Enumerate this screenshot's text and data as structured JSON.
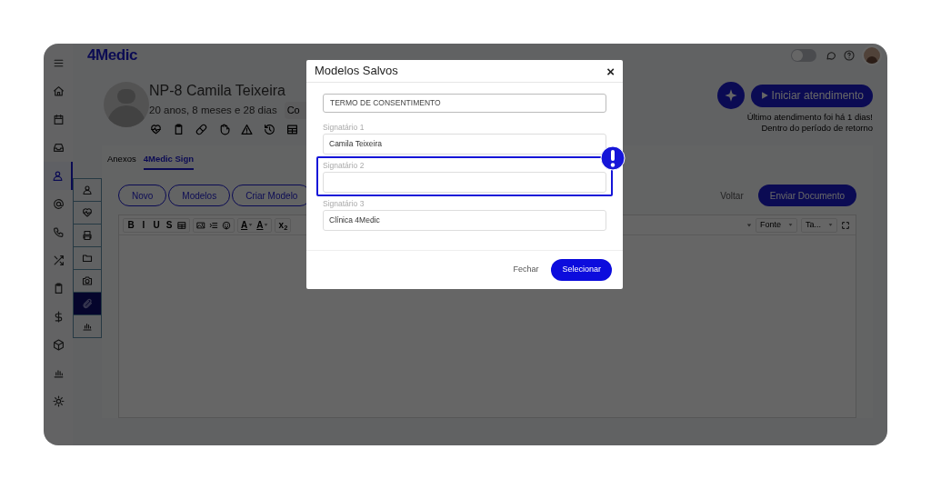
{
  "app": {
    "logo": "4Medic"
  },
  "sidebar": {
    "items": [
      {
        "kind": "menu",
        "selected": false
      },
      {
        "kind": "home",
        "selected": false
      },
      {
        "kind": "calendar",
        "selected": false
      },
      {
        "kind": "inbox",
        "selected": false
      },
      {
        "kind": "user",
        "selected": true
      },
      {
        "kind": "at",
        "selected": false
      },
      {
        "kind": "phone",
        "selected": false
      },
      {
        "kind": "shuffle",
        "selected": false
      },
      {
        "kind": "clipboard",
        "selected": false
      },
      {
        "kind": "dollar",
        "selected": false
      },
      {
        "kind": "cube",
        "selected": false
      },
      {
        "kind": "chart",
        "selected": false
      },
      {
        "kind": "gear",
        "selected": false
      }
    ]
  },
  "topbar": {
    "toggle": {
      "on": false
    }
  },
  "patient": {
    "name": "NP-8 Camila Teixeira",
    "age": "20 anos, 8 meses e 28 dias",
    "badge": "Co"
  },
  "actions": {
    "start_button": "Iniciar atendimento",
    "note_lines": [
      "Último atendimento foi há 1 dias!",
      "Dentro do período de retorno"
    ]
  },
  "sub_sidebar": {
    "items": [
      {
        "kind": "user",
        "selected": false
      },
      {
        "kind": "heartbeat",
        "selected": false
      },
      {
        "kind": "printer",
        "selected": false
      },
      {
        "kind": "folder",
        "selected": false
      },
      {
        "kind": "camera",
        "selected": false
      },
      {
        "kind": "paperclip",
        "selected": true
      },
      {
        "kind": "chart",
        "selected": false
      }
    ]
  },
  "tabs": [
    {
      "label": "Anexos",
      "selected": false
    },
    {
      "label": "4Medic Sign",
      "selected": true
    }
  ],
  "buttons": [
    "Novo",
    "Modelos",
    "Criar Modelo"
  ],
  "back_link": "Voltar",
  "send_button": "Enviar Documento",
  "editor": {
    "toolbar": [
      [
        {
          "kind": "text",
          "label": "B"
        },
        {
          "kind": "text",
          "label": "I"
        },
        {
          "kind": "text",
          "label": "U"
        },
        {
          "kind": "text",
          "label": "S"
        },
        {
          "kind": "table"
        }
      ],
      [
        {
          "kind": "image"
        },
        {
          "kind": "indent"
        },
        {
          "kind": "emoji"
        }
      ],
      [
        {
          "kind": "dropdown",
          "label": "A"
        },
        {
          "kind": "dropdown",
          "label": "A"
        }
      ],
      [
        {
          "kind": "text",
          "label": "x$_{2}$"
        }
      ]
    ],
    "right_toolbar": [
      {
        "kind": "caret"
      },
      {
        "kind": "dropdown",
        "label": "Fonte"
      },
      {
        "kind": "dropdown",
        "label": "Ta..."
      },
      {
        "kind": "fullscreen"
      }
    ]
  },
  "modal": {
    "title": "Modelos Salvos",
    "close": "×",
    "template": "TERMO DE CONSENTIMENTO",
    "signatories": [
      {
        "label": "Signatário 1",
        "value": "Camila Teixeira",
        "highlighted": false
      },
      {
        "label": "Signatário 2",
        "highlighted": true
      },
      {
        "label": "Signatário 3",
        "value": "Clínica 4Medic",
        "highlighted": false
      }
    ],
    "cancel": "Fechar",
    "confirm": "Selecionar"
  }
}
